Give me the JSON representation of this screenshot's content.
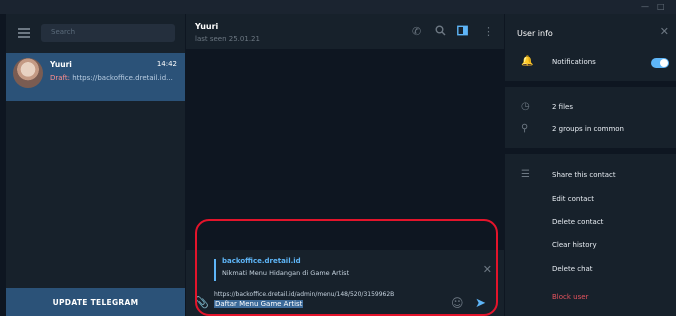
{
  "window": {
    "minimize_label": "—",
    "restore_label": "□"
  },
  "sidebar": {
    "search_placeholder": "Search",
    "chats": [
      {
        "name": "Yuuri",
        "time": "14:42",
        "draft_prefix": "Draft:",
        "draft_text": " https://backoffice.dretail.id..."
      }
    ],
    "update_button": "UPDATE TELEGRAM"
  },
  "chat": {
    "name": "Yuuri",
    "status": "last seen 25.01.21",
    "reply": {
      "title": "backoffice.dretail.id",
      "text": "Nikmati Menu Hidangan di Game Artist"
    },
    "compose": {
      "url_line": "https://backoffice.dretail.id/admin/menu/148/520/3159962B",
      "selected_text": "Daftar Menu Game Artist"
    }
  },
  "user_info": {
    "title": "User info",
    "notifications_label": "Notifications",
    "notifications_on": true,
    "files_label": "2 files",
    "groups_label": "2 groups in common",
    "actions": [
      "Share this contact",
      "Edit contact",
      "Delete contact",
      "Clear history",
      "Delete chat"
    ],
    "block_label": "Block user"
  },
  "colors": {
    "accent": "#5eb5f7",
    "selected_chat": "#2b5278",
    "danger": "#e5535e",
    "highlight_box": "#e3142b"
  }
}
